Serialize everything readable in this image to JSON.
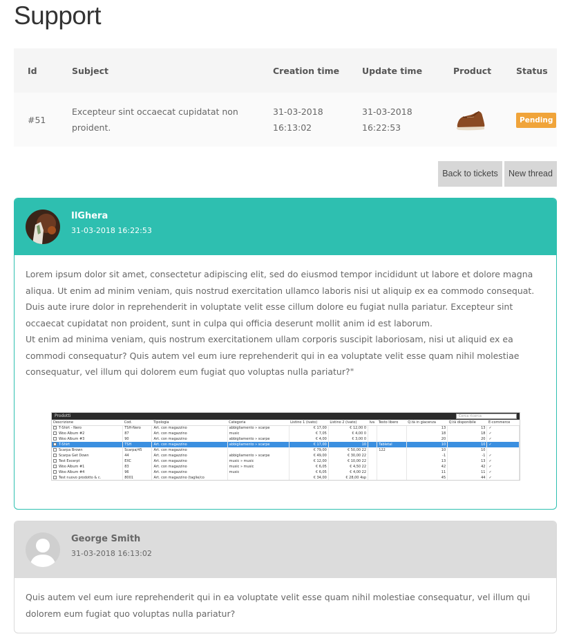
{
  "page": {
    "title": "Support"
  },
  "table": {
    "headers": {
      "id": "Id",
      "subject": "Subject",
      "creation": "Creation time",
      "update": "Update time",
      "product": "Product",
      "status": "Status"
    },
    "row": {
      "id": "#51",
      "subject": "Excepteur sint occaecat cupidatat non proident.",
      "creation_date": "31-03-2018",
      "creation_time": "16:13:02",
      "update_date": "31-03-2018",
      "update_time": "16:22:53",
      "product_image": "shoe-icon",
      "status": "Pending",
      "status_color": "#f0a43a"
    }
  },
  "actions": {
    "back": "Back to tickets",
    "new_thread": "New thread"
  },
  "messages": [
    {
      "author": "IlGhera",
      "date": "31-03-2018 16:22:53",
      "header_color": "#2ebfb0",
      "paragraph1": "Lorem ipsum dolor sit amet, consectetur adipiscing elit, sed do eiusmod tempor incididunt ut labore et dolore magna aliqua. Ut enim ad minim veniam, quis nostrud exercitation ullamco laboris nisi ut aliquip ex ea commodo consequat. Duis aute irure dolor in reprehenderit in voluptate velit esse cillum dolore eu fugiat nulla pariatur. Excepteur sint occaecat cupidatat non proident, sunt in culpa qui officia deserunt mollit anim id est laborum.",
      "paragraph2": "Ut enim ad minima veniam, quis nostrum exercitationem ullam corporis suscipit laboriosam, nisi ut aliquid ex ea commodi consequatur? Quis autem vel eum iure reprehenderit qui in ea voluptate velit esse quam nihil molestiae consequatur, vel illum qui dolorem eum fugiat quo voluptas nulla pariatur?\"",
      "attachment": {
        "title": "Prodotti",
        "search_placeholder": "Cerca ricerca",
        "headers": [
          "Descrizione",
          "Cod.",
          "Tipologia",
          "Categoria",
          "Listino 1 (ivato)",
          "Listino 2 (ivato)",
          "Iva",
          "Testo libero",
          "Q.tà in giacenza",
          "Q.tà disponibile",
          "E-commerce"
        ],
        "rows": [
          [
            "T-Shirt - Nero",
            "TSH-Nero",
            "Art. con magazzino",
            "abbigliamento » scarpe",
            "€ 17,00",
            "€ 12,00 0",
            "",
            "",
            "13",
            "13",
            "✓"
          ],
          [
            "Woo Album #2",
            "87",
            "Art. con magazzino",
            "music",
            "€ 7,05",
            "€ 4,00 0",
            "",
            "",
            "18",
            "18",
            "✓"
          ],
          [
            "Woo Album #3",
            "90",
            "Art. con magazzino",
            "abbigliamento » scarpe",
            "€ 4,00",
            "€ 3,00 0",
            "",
            "",
            "20",
            "20",
            "✓"
          ],
          [
            "T-Shirt",
            "TSH",
            "Art. con magazzino",
            "abbigliamento » scarpe",
            "€ 17,00",
            "10",
            "",
            "Tabletal",
            "10",
            "10",
            "✓"
          ],
          [
            "Scarpa Brown",
            "Scarpa/45",
            "Art. con magazzino",
            "",
            "€ 79,00",
            "€ 50,00 22",
            "",
            "122",
            "10",
            "10",
            ""
          ],
          [
            "Scarpa Get Down",
            "44",
            "Art. con magazzino",
            "abbigliamento » scarpe",
            "€ 49,00",
            "€ 30,00 22",
            "",
            "",
            "-1",
            "-1",
            "✓"
          ],
          [
            "Test Excerpt",
            "EXC",
            "Art. con magazzino",
            "music » music",
            "€ 12,00",
            "€ 10,00 22",
            "",
            "",
            "13",
            "13",
            "✓"
          ],
          [
            "Woo Album #1",
            "83",
            "Art. con magazzino",
            "music » music",
            "€ 6,05",
            "€ 4,50 22",
            "",
            "",
            "42",
            "42",
            "✓"
          ],
          [
            "Woo Album #4",
            "96",
            "Art. con magazzino",
            "music",
            "€ 6,05",
            "€ 4,00 22",
            "",
            "",
            "11",
            "11",
            "✓"
          ],
          [
            "Test nuovo prodotto & c.",
            "8001",
            "Art. con magazzino (taglie/co",
            "",
            "€ 34,00",
            "€ 28,00 4sp",
            "",
            "",
            "45",
            "44",
            "✓"
          ]
        ],
        "selected_row": 3
      }
    },
    {
      "author": "George Smith",
      "date": "31-03-2018 16:13:02",
      "header_color": "#dcdcdc",
      "paragraph1": "Quis autem vel eum iure reprehenderit qui in ea voluptate velit esse quam nihil molestiae consequatur, vel illum qui dolorem eum fugiat quo voluptas nulla pariatur?"
    }
  ]
}
